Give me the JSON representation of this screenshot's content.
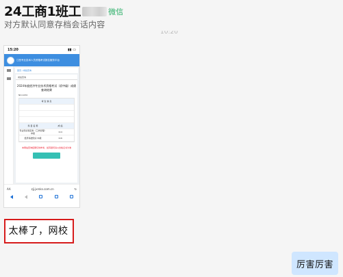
{
  "header": {
    "title": "24工商1班工",
    "tag": "微信",
    "subtitle": "对方默认同意存档会话内容",
    "timestamp": "10:20"
  },
  "screenshot": {
    "status_time": "15:20",
    "site_title": "江西专业技术人员资格考试报名服务平台",
    "crumb": "首页 / 成绩查询",
    "card_header": "成绩查询",
    "card_title": "2024年度经济专业技术资格考试（初中级）成绩查询结果",
    "card_number": "NO.1234",
    "table_header": "考 生 信 息",
    "score_header_left": "科 目 名 称",
    "score_header_right": "成 绩",
    "row1_label": "专业知识和实务（工商管理）中级",
    "row1_value": "114",
    "row2_label": "经济基础知识 中级",
    "row2_value": "116",
    "warning": "本网站查询结果仅供参考，如有疑问请以合格证书为准",
    "address": "zjj.jxrsks.com.cn",
    "address_prefix": "AA"
  },
  "messages": {
    "received": "太棒了，网校",
    "sent": "厉害厉害"
  }
}
